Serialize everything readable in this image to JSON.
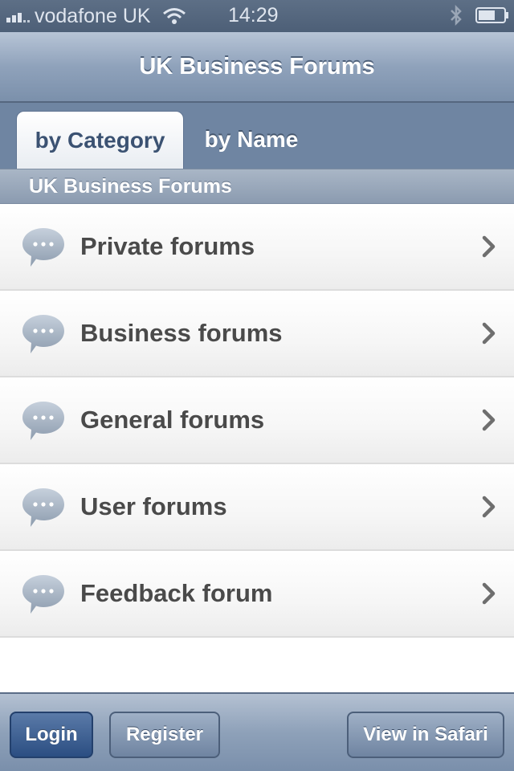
{
  "status_bar": {
    "carrier": "vodafone UK",
    "time": "14:29",
    "icons": [
      "signal-icon",
      "wifi-icon",
      "bluetooth-icon",
      "battery-icon"
    ]
  },
  "header": {
    "title": "UK Business Forums"
  },
  "tabs": [
    {
      "label": "by Category",
      "active": true
    },
    {
      "label": "by Name",
      "active": false
    }
  ],
  "section": {
    "title": "UK Business Forums"
  },
  "forums": [
    {
      "label": "Private forums",
      "icon": "speech-bubble-icon"
    },
    {
      "label": "Business forums",
      "icon": "speech-bubble-icon"
    },
    {
      "label": "General forums",
      "icon": "speech-bubble-icon"
    },
    {
      "label": "User forums",
      "icon": "speech-bubble-icon"
    },
    {
      "label": "Feedback forum",
      "icon": "speech-bubble-icon"
    }
  ],
  "toolbar": {
    "login_label": "Login",
    "register_label": "Register",
    "safari_label": "View in Safari"
  },
  "colors": {
    "accent": "#3b5272",
    "title_bar": "#8fa2bb",
    "tab_strip": "#6f85a2",
    "login_button": "#2b4e82"
  }
}
